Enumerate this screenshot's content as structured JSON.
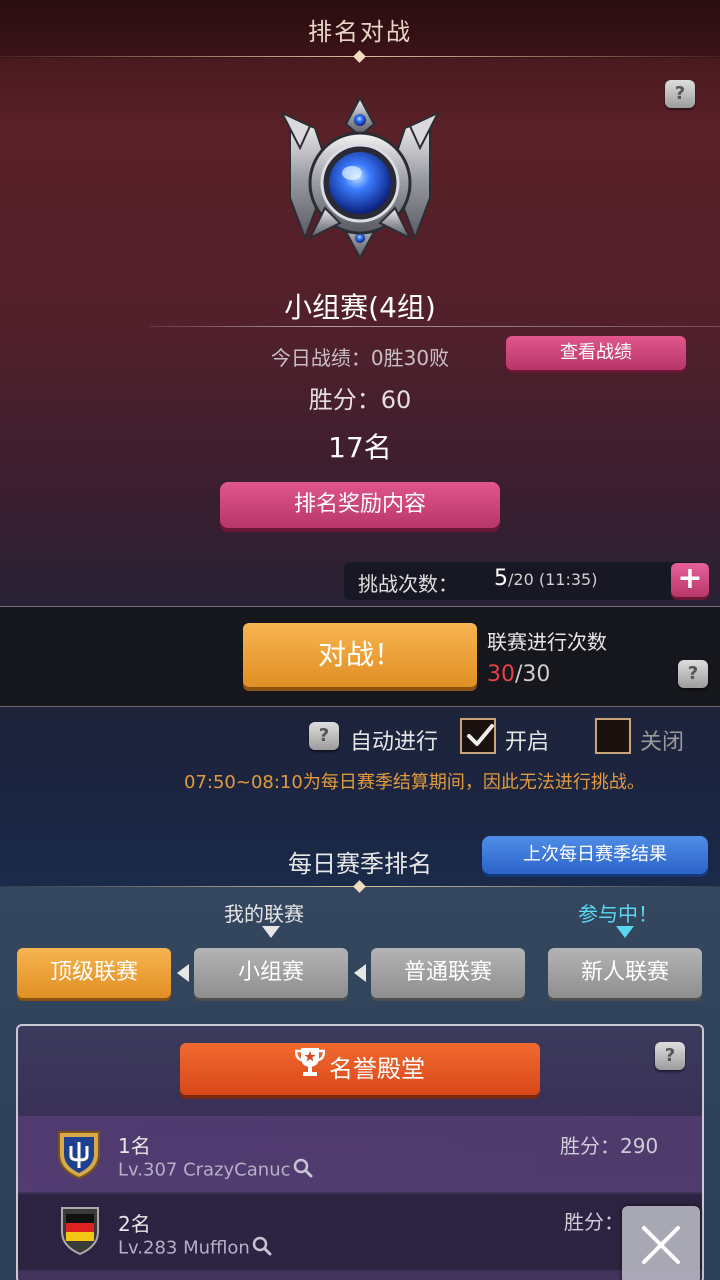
{
  "header": {
    "title": "排名对战"
  },
  "league": {
    "title": "小组赛(4组)",
    "today_record": "今日战绩：0胜30败",
    "view_record_button": "查看战绩",
    "win_points": "胜分：60",
    "rank": "17名",
    "reward_button": "排名奖励内容"
  },
  "challenge": {
    "label": "挑战次数：",
    "current": "5",
    "total": "/20",
    "timer": "(11:35)",
    "plus_symbol": "+"
  },
  "battle": {
    "button": "对战！",
    "league_count_label": "联赛进行次数",
    "league_count_used": "30",
    "league_count_total": "/30"
  },
  "auto": {
    "label": "自动进行",
    "on_label": "开启",
    "off_label": "关闭",
    "on_checked": true,
    "notice": "07:50~08:10为每日赛季结算期间，因此无法进行挑战。"
  },
  "daily": {
    "title": "每日赛季排名",
    "last_result_button": "上次每日赛季结果",
    "my_league_label": "我的联赛",
    "participating_label": "参与中！",
    "tabs": [
      {
        "label": "顶级联赛",
        "active": true
      },
      {
        "label": "小组赛",
        "active": false
      },
      {
        "label": "普通联赛",
        "active": false
      },
      {
        "label": "新人联赛",
        "active": false
      }
    ]
  },
  "hall_of_fame": {
    "button": "名誉殿堂",
    "entries": [
      {
        "rank": "1名",
        "player": "Lv.307 CrazyCanuc",
        "score": "胜分：290",
        "emblem": "shield-trident-icon"
      },
      {
        "rank": "2名",
        "player": "Lv.283 Mufflon",
        "score": "胜分：",
        "emblem": "germany-flag-shield-icon"
      }
    ]
  },
  "icons": {
    "help": "?",
    "close": "close-icon",
    "search": "magnifier-icon"
  },
  "colors": {
    "pink_button": "#c8417a",
    "orange_button": "#eea03a",
    "blue_button": "#3b77d8",
    "hall_button": "#e65724",
    "notice_text": "#e29a3d",
    "participating": "#59d7f3",
    "red_count": "#e8414b"
  }
}
